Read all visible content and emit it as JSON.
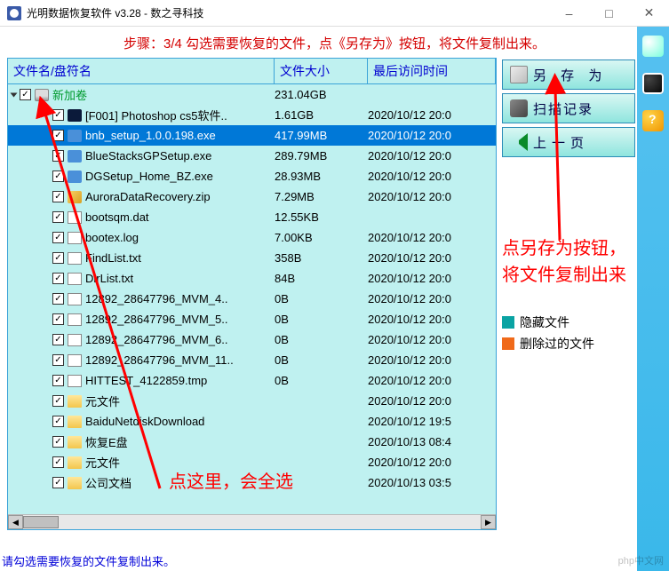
{
  "window": {
    "title": "光明数据恢复软件 v3.28 - 数之寻科技"
  },
  "step_text": "步骤：3/4 勾选需要恢复的文件，点《另存为》按钮，将文件复制出来。",
  "buttons": {
    "save_as": "另 存 为",
    "scan_log": "扫描记录",
    "prev_page": "上一页"
  },
  "columns": {
    "name": "文件名/盘符名",
    "size": "文件大小",
    "atime": "最后访问时间"
  },
  "root": {
    "label": "新加卷",
    "size": "231.04GB",
    "atime": ""
  },
  "files": [
    {
      "name": "[F001] Photoshop cs5软件..",
      "size": "1.61GB",
      "atime": "2020/10/12 20:0",
      "icon": "ps",
      "sel": false
    },
    {
      "name": "bnb_setup_1.0.0.198.exe",
      "size": "417.99MB",
      "atime": "2020/10/12 20:0",
      "icon": "exe",
      "sel": true
    },
    {
      "name": "BlueStacksGPSetup.exe",
      "size": "289.79MB",
      "atime": "2020/10/12 20:0",
      "icon": "exe",
      "sel": false
    },
    {
      "name": "DGSetup_Home_BZ.exe",
      "size": "28.93MB",
      "atime": "2020/10/12 20:0",
      "icon": "exe",
      "sel": false
    },
    {
      "name": "AuroraDataRecovery.zip",
      "size": "7.29MB",
      "atime": "2020/10/12 20:0",
      "icon": "zip",
      "sel": false
    },
    {
      "name": "bootsqm.dat",
      "size": "12.55KB",
      "atime": "",
      "icon": "dat",
      "sel": false
    },
    {
      "name": "bootex.log",
      "size": "7.00KB",
      "atime": "2020/10/12 20:0",
      "icon": "txt",
      "sel": false
    },
    {
      "name": "FindList.txt",
      "size": "358B",
      "atime": "2020/10/12 20:0",
      "icon": "txt",
      "sel": false
    },
    {
      "name": "DirList.txt",
      "size": "84B",
      "atime": "2020/10/12 20:0",
      "icon": "txt",
      "sel": false
    },
    {
      "name": "12892_28647796_MVM_4..",
      "size": "0B",
      "atime": "2020/10/12 20:0",
      "icon": "tmp",
      "sel": false
    },
    {
      "name": "12892_28647796_MVM_5..",
      "size": "0B",
      "atime": "2020/10/12 20:0",
      "icon": "tmp",
      "sel": false
    },
    {
      "name": "12892_28647796_MVM_6..",
      "size": "0B",
      "atime": "2020/10/12 20:0",
      "icon": "tmp",
      "sel": false
    },
    {
      "name": "12892_28647796_MVM_11..",
      "size": "0B",
      "atime": "2020/10/12 20:0",
      "icon": "tmp",
      "sel": false
    },
    {
      "name": "HITTEST_4122859.tmp",
      "size": "0B",
      "atime": "2020/10/12 20:0",
      "icon": "tmp",
      "sel": false
    },
    {
      "name": "元文件",
      "size": "",
      "atime": "2020/10/12 20:0",
      "icon": "folder",
      "sel": false
    },
    {
      "name": "BaiduNetdiskDownload",
      "size": "",
      "atime": "2020/10/12 19:5",
      "icon": "folder",
      "sel": false
    },
    {
      "name": "恢复E盘",
      "size": "",
      "atime": "2020/10/13 08:4",
      "icon": "folder",
      "sel": false
    },
    {
      "name": "元文件",
      "size": "",
      "atime": "2020/10/12 20:0",
      "icon": "folder",
      "sel": false
    },
    {
      "name": "公司文档",
      "size": "",
      "atime": "2020/10/13 03:5",
      "icon": "folder",
      "sel": false
    }
  ],
  "legend": {
    "hidden": "隐藏文件",
    "deleted": "删除过的文件",
    "hidden_color": "#0aa3a3",
    "deleted_color": "#f06a1a"
  },
  "annotations": {
    "click_here": "点这里，会全选",
    "click_saveas": "点另存为按钮，将文件复制出来"
  },
  "footer": "请勾选需要恢复的文件复制出来。",
  "watermark": "php中文网"
}
